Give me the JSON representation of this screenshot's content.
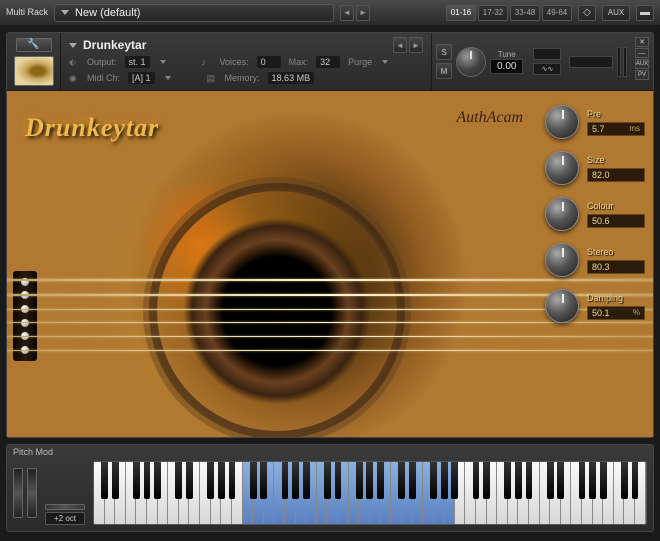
{
  "topbar": {
    "multi_rack": "Multi\nRack",
    "preset": "New (default)",
    "pages": [
      "01-16",
      "17-32",
      "33-48",
      "49-64"
    ],
    "active_page": 0,
    "aux": "AUX"
  },
  "instrument": {
    "name": "Drunkeytar",
    "output_label": "Output:",
    "output_value": "st. 1",
    "midi_label": "Midi Ch:",
    "midi_value": "[A] 1",
    "voices_label": "Voices:",
    "voices_value": "0",
    "max_label": "Max:",
    "max_value": "32",
    "purge_label": "Purge",
    "memory_label": "Memory:",
    "memory_value": "18.63 MB",
    "solo": "S",
    "mute": "M",
    "tune_label": "Tune",
    "tune_value": "0.00",
    "logo_text": "Drunkeytar",
    "script_text": "AuthAcam"
  },
  "knobs": [
    {
      "label": "Pre",
      "value": "5.7",
      "unit": "ms"
    },
    {
      "label": "Size",
      "value": "82.0",
      "unit": ""
    },
    {
      "label": "Colour",
      "value": "50.6",
      "unit": ""
    },
    {
      "label": "Stereo",
      "value": "80.3",
      "unit": ""
    },
    {
      "label": "Damping",
      "value": "50.1",
      "unit": "%"
    }
  ],
  "bottom": {
    "pitch_mod": "Pitch Mod",
    "octave": "+2 oct"
  }
}
